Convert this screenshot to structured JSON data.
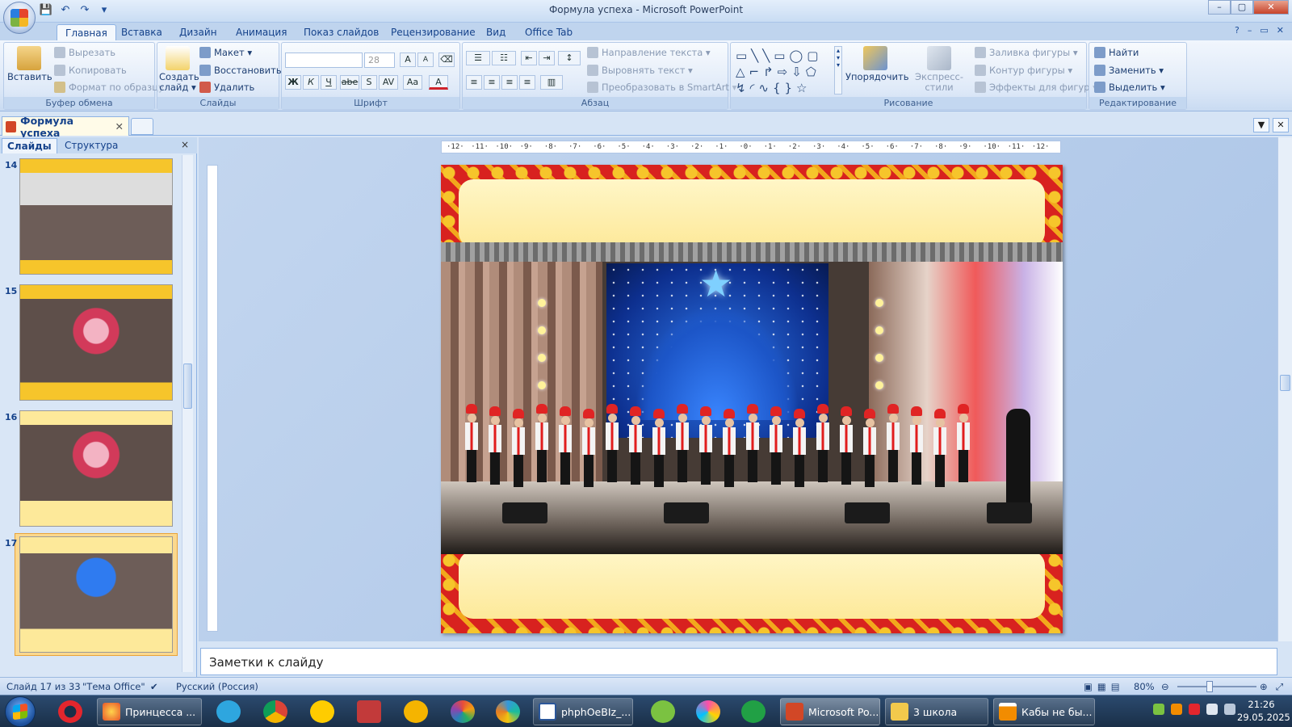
{
  "window": {
    "title": "Формула успеха - Microsoft PowerPoint",
    "controls": [
      "–",
      "▢",
      "✕"
    ]
  },
  "tabs": [
    "Главная",
    "Вставка",
    "Дизайн",
    "Анимация",
    "Показ слайдов",
    "Рецензирование",
    "Вид",
    "Office Tab"
  ],
  "ribbon": {
    "clipboard": {
      "label": "Буфер обмена",
      "paste": "Вставить",
      "cut": "Вырезать",
      "copy": "Копировать",
      "format_painter": "Формат по образцу"
    },
    "slides": {
      "label": "Слайды",
      "new_slide_line1": "Создать",
      "new_slide_line2": "слайд ▾",
      "layout": "Макет ▾",
      "reset": "Восстановить",
      "delete": "Удалить"
    },
    "font": {
      "label": "Шрифт",
      "font_name": "",
      "font_size": "28",
      "bold": "Ж",
      "italic": "К",
      "underline": "Ч",
      "strike": "abe",
      "shadow": "S",
      "spacing": "AV",
      "case": "Aa",
      "color": "A",
      "grow": "A",
      "shrink": "A"
    },
    "paragraph": {
      "label": "Абзац",
      "text_direction": "Направление текста ▾",
      "align_text": "Выровнять текст ▾",
      "smartart": "Преобразовать в SmartArt ▾"
    },
    "drawing": {
      "label": "Рисование",
      "arrange": "Упорядочить",
      "quick_styles": "Экспресс-стили",
      "shape_fill": "Заливка фигуры ▾",
      "shape_outline": "Контур фигуры ▾",
      "shape_effects": "Эффекты для фигур ▾"
    },
    "editing": {
      "label": "Редактирование",
      "find": "Найти",
      "replace": "Заменить ▾",
      "select": "Выделить ▾"
    }
  },
  "document_tab": {
    "name": "Формула успеха",
    "close": "✕"
  },
  "slide_panel": {
    "tab_slides": "Слайды",
    "tab_outline": "Структура",
    "close": "×",
    "slides": [
      {
        "num": "14"
      },
      {
        "num": "15"
      },
      {
        "num": "16"
      },
      {
        "num": "17"
      }
    ]
  },
  "ruler": {
    "ticks": [
      "·12·",
      "·11·",
      "·10·",
      "·9·",
      "·8·",
      "·7·",
      "·6·",
      "·5·",
      "·4·",
      "·3·",
      "·2·",
      "·1·",
      "·0·",
      "·1·",
      "·2·",
      "·3·",
      "·4·",
      "·5·",
      "·6·",
      "·7·",
      "·8·",
      "·9·",
      "·10·",
      "·11·",
      "·12·"
    ]
  },
  "notes": {
    "placeholder": "Заметки к слайду"
  },
  "status": {
    "slide_counter": "Слайд 17 из 33",
    "theme": "\"Тема Office\"",
    "language": "Русский (Россия)",
    "zoom": "80%"
  },
  "taskbar": {
    "windows": [
      {
        "label": "Принцесса ..."
      },
      {
        "label": "phphOeBIz_..."
      },
      {
        "label": "Microsoft Po..."
      },
      {
        "label": "3 школа"
      },
      {
        "label": "Кабы не бы..."
      }
    ],
    "time": "21:26",
    "date": "29.05.2025"
  },
  "colors": {
    "ribbon_bg": "#dbe7f7",
    "accent_text": "#15428b",
    "selected_thumb": "#f7b54f",
    "frame_red": "#d8221f",
    "frame_gold": "#f6c52b"
  }
}
